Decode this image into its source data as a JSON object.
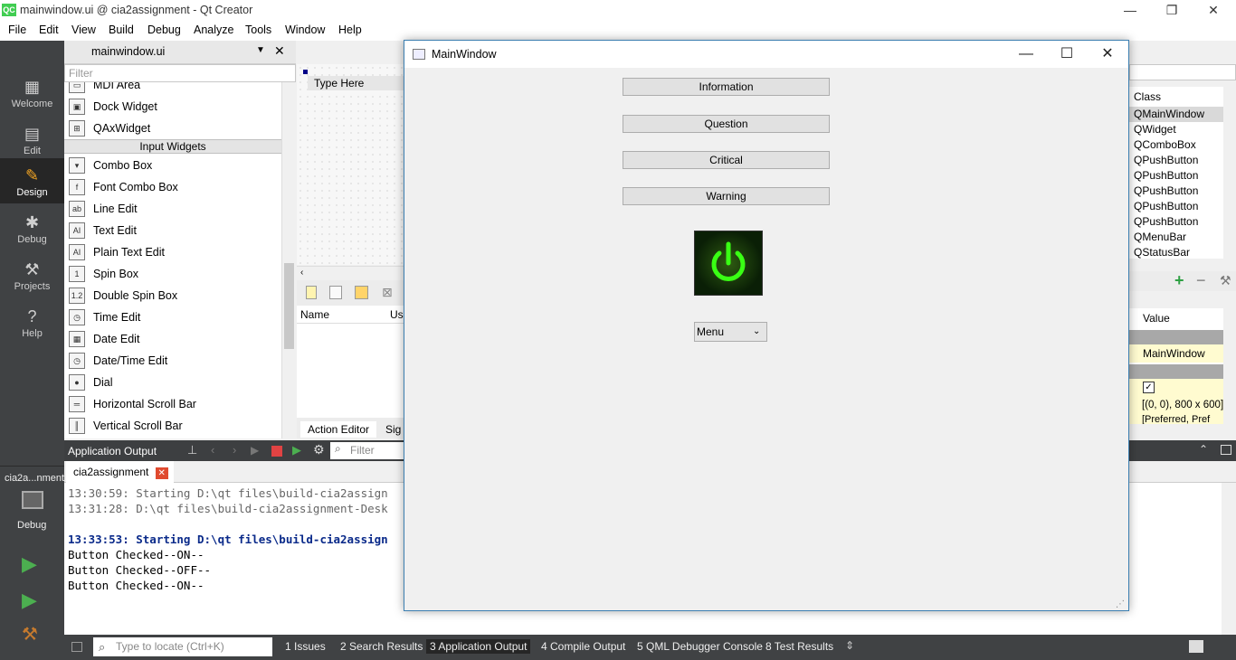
{
  "window": {
    "title": "mainwindow.ui @ cia2assignment - Qt Creator",
    "logo": "QC",
    "controls": [
      "—",
      "❐",
      "✕"
    ]
  },
  "menubar": [
    "File",
    "Edit",
    "View",
    "Build",
    "Debug",
    "Analyze",
    "Tools",
    "Window",
    "Help"
  ],
  "modes": [
    {
      "label": "Welcome",
      "icon": "grid-icon"
    },
    {
      "label": "Edit",
      "icon": "document-icon"
    },
    {
      "label": "Design",
      "icon": "pencil-icon"
    },
    {
      "label": "Debug",
      "icon": "bug-icon"
    },
    {
      "label": "Projects",
      "icon": "wrench-icon"
    },
    {
      "label": "Help",
      "icon": "help-icon"
    }
  ],
  "kit": {
    "project": "cia2a...nment",
    "mode": "Debug"
  },
  "editor": {
    "file_name": "mainwindow.ui",
    "filter_placeholder": "Filter",
    "type_here": "Type Here"
  },
  "widget_box": {
    "items_top": [
      "MDI Area",
      "Dock Widget",
      "QAxWidget"
    ],
    "category": "Input Widgets",
    "items": [
      {
        "label": "Combo Box",
        "glyph": "▾"
      },
      {
        "label": "Font Combo Box",
        "glyph": "f"
      },
      {
        "label": "Line Edit",
        "glyph": "ab"
      },
      {
        "label": "Text Edit",
        "glyph": "AI"
      },
      {
        "label": "Plain Text Edit",
        "glyph": "AI"
      },
      {
        "label": "Spin Box",
        "glyph": "1"
      },
      {
        "label": "Double Spin Box",
        "glyph": "1.2"
      },
      {
        "label": "Time Edit",
        "glyph": "◷"
      },
      {
        "label": "Date Edit",
        "glyph": "▦"
      },
      {
        "label": "Date/Time Edit",
        "glyph": "◷"
      },
      {
        "label": "Dial",
        "glyph": "●"
      },
      {
        "label": "Horizontal Scroll Bar",
        "glyph": "═"
      },
      {
        "label": "Vertical Scroll Bar",
        "glyph": "║"
      }
    ]
  },
  "action_editor": {
    "col_name": "Name",
    "col_used": "Us",
    "tab1": "Action Editor",
    "tab2": "Sig"
  },
  "object_inspector": {
    "header": "Class",
    "rows": [
      "QMainWindow",
      "QWidget",
      "QComboBox",
      "QPushButton",
      "QPushButton",
      "QPushButton",
      "QPushButton",
      "QPushButton",
      "QMenuBar",
      "QStatusBar"
    ]
  },
  "property_editor": {
    "header": "Value",
    "object_name": "MainWindow",
    "geometry": "[(0, 0), 800 x 600]",
    "size_policy": "[Preferred, Pref"
  },
  "output_pane": {
    "title": "Application Output",
    "filter_placeholder": "Filter",
    "tab": "cia2assignment",
    "lines": [
      {
        "text": "13:30:59: Starting D:\\qt files\\build-cia2assign",
        "style": "gray"
      },
      {
        "text": "13:31:28: D:\\qt files\\build-cia2assignment-Desk",
        "style": "gray"
      },
      {
        "text": "",
        "style": "plain"
      },
      {
        "text": "13:33:53: Starting D:\\qt files\\build-cia2assign",
        "style": "bold-blue"
      },
      {
        "text": "Button Checked--ON--",
        "style": "plain"
      },
      {
        "text": "Button Checked--OFF--",
        "style": "plain"
      },
      {
        "text": "Button Checked--ON--",
        "style": "plain"
      }
    ]
  },
  "statusbar": {
    "locate_placeholder": "Type to locate (Ctrl+K)",
    "tabs": [
      "1  Issues",
      "2  Search Results",
      "3  Application Output",
      "4  Compile Output",
      "5  QML Debugger Console",
      "8  Test Results"
    ],
    "active_tab_index": 2
  },
  "main_window": {
    "title": "MainWindow",
    "buttons": [
      "Information",
      "Question",
      "Critical",
      "Warning"
    ],
    "combo_value": "Menu",
    "power_icon": "power-icon",
    "accent": "#39ff14"
  }
}
